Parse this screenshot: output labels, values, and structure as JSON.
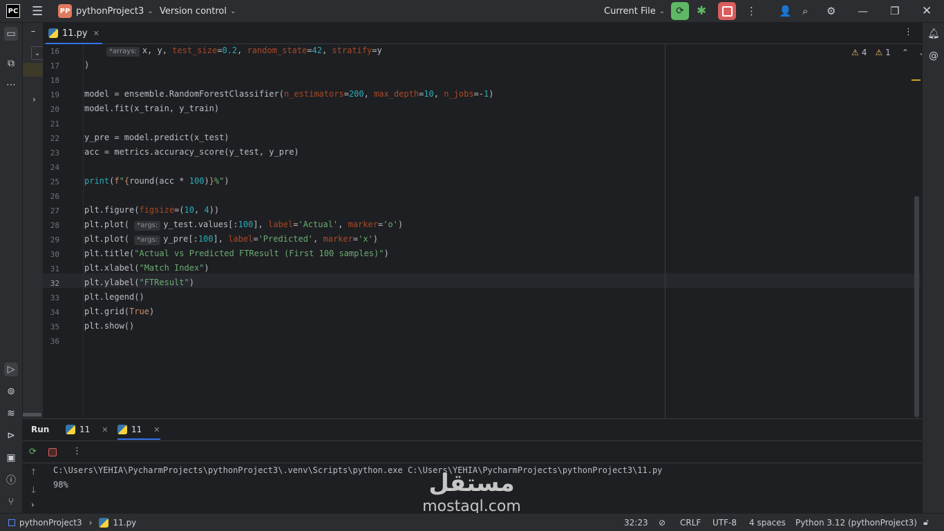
{
  "titlebar": {
    "logo": "PC",
    "project_badge": "PP",
    "project_name": "pythonProject3",
    "vcs": "Version control",
    "run_config": "Current File"
  },
  "editor": {
    "tab_file": "11.py",
    "inspection_warnings": "4",
    "inspection_weak": "1",
    "lines": [
      {
        "n": "16",
        "segs": [
          [
            "hint",
            "*arrays:"
          ],
          [
            "t",
            "x, y, "
          ],
          [
            "param",
            "test_size"
          ],
          [
            "t",
            "="
          ],
          [
            "num",
            "0.2"
          ],
          [
            "t",
            ", "
          ],
          [
            "param",
            "random_state"
          ],
          [
            "t",
            "="
          ],
          [
            "num",
            "42"
          ],
          [
            "t",
            ", "
          ],
          [
            "param",
            "stratify"
          ],
          [
            "t",
            "=y"
          ]
        ]
      },
      {
        "n": "17",
        "segs": [
          [
            "t",
            ")"
          ]
        ]
      },
      {
        "n": "18",
        "segs": []
      },
      {
        "n": "19",
        "segs": [
          [
            "t",
            "model = ensemble.RandomForestClassifier("
          ],
          [
            "param",
            "n_estimators"
          ],
          [
            "t",
            "="
          ],
          [
            "num",
            "200"
          ],
          [
            "t",
            ", "
          ],
          [
            "param",
            "max_depth"
          ],
          [
            "t",
            "="
          ],
          [
            "num",
            "10"
          ],
          [
            "t",
            ", "
          ],
          [
            "param",
            "n_jobs"
          ],
          [
            "t",
            "=-"
          ],
          [
            "num",
            "1"
          ],
          [
            "t",
            ")"
          ]
        ]
      },
      {
        "n": "20",
        "segs": [
          [
            "t",
            "model.fit(x_train, y_train)"
          ]
        ]
      },
      {
        "n": "21",
        "segs": []
      },
      {
        "n": "22",
        "segs": [
          [
            "t",
            "y_pre = model.predict(x_test)"
          ]
        ]
      },
      {
        "n": "23",
        "segs": [
          [
            "t",
            "acc = metrics.accuracy_score(y_test, y_pre)"
          ]
        ]
      },
      {
        "n": "24",
        "segs": []
      },
      {
        "n": "25",
        "segs": [
          [
            "num",
            "print"
          ],
          [
            "t",
            "("
          ],
          [
            "kw",
            "f"
          ],
          [
            "str",
            "\""
          ],
          [
            "kw",
            "{"
          ],
          [
            "t",
            "round(acc * "
          ],
          [
            "num",
            "100"
          ],
          [
            "t",
            ")"
          ],
          [
            "kw",
            "}"
          ],
          [
            "str",
            "%\""
          ],
          [
            "t",
            ")"
          ]
        ]
      },
      {
        "n": "26",
        "segs": []
      },
      {
        "n": "27",
        "segs": [
          [
            "t",
            "plt.figure("
          ],
          [
            "param",
            "figsize"
          ],
          [
            "t",
            "=("
          ],
          [
            "num",
            "10"
          ],
          [
            "t",
            ", "
          ],
          [
            "num",
            "4"
          ],
          [
            "t",
            "))"
          ]
        ]
      },
      {
        "n": "28",
        "segs": [
          [
            "t",
            "plt.plot( "
          ],
          [
            "hint",
            "*args:"
          ],
          [
            "t",
            "y_test.values[:"
          ],
          [
            "num",
            "100"
          ],
          [
            "t",
            "], "
          ],
          [
            "param",
            "label"
          ],
          [
            "t",
            "="
          ],
          [
            "str",
            "'Actual'"
          ],
          [
            "t",
            ", "
          ],
          [
            "param",
            "marker"
          ],
          [
            "t",
            "="
          ],
          [
            "str",
            "'o'"
          ],
          [
            "t",
            ")"
          ]
        ]
      },
      {
        "n": "29",
        "segs": [
          [
            "t",
            "plt.plot( "
          ],
          [
            "hint",
            "*args:"
          ],
          [
            "t",
            "y_pre[:"
          ],
          [
            "num",
            "100"
          ],
          [
            "t",
            "], "
          ],
          [
            "param",
            "label"
          ],
          [
            "t",
            "="
          ],
          [
            "str",
            "'Predicted'"
          ],
          [
            "t",
            ", "
          ],
          [
            "param",
            "marker"
          ],
          [
            "t",
            "="
          ],
          [
            "str",
            "'x'"
          ],
          [
            "t",
            ")"
          ]
        ]
      },
      {
        "n": "30",
        "segs": [
          [
            "t",
            "plt.title("
          ],
          [
            "str",
            "\"Actual vs Predicted FTResult (First 100 samples)\""
          ],
          [
            "t",
            ")"
          ]
        ]
      },
      {
        "n": "31",
        "segs": [
          [
            "t",
            "plt.xlabel("
          ],
          [
            "str",
            "\"Match Index\""
          ],
          [
            "t",
            ")"
          ]
        ]
      },
      {
        "n": "32",
        "segs": [
          [
            "t",
            "plt.ylabel("
          ],
          [
            "str",
            "\"FTResult\""
          ],
          [
            "t",
            ")"
          ]
        ]
      },
      {
        "n": "33",
        "segs": [
          [
            "t",
            "plt.legend()"
          ]
        ]
      },
      {
        "n": "34",
        "segs": [
          [
            "t",
            "plt.grid("
          ],
          [
            "kw",
            "True"
          ],
          [
            "t",
            ")"
          ]
        ]
      },
      {
        "n": "35",
        "segs": [
          [
            "t",
            "plt.show()"
          ]
        ]
      },
      {
        "n": "36",
        "segs": []
      }
    ]
  },
  "run": {
    "title": "Run",
    "tab1": "11",
    "tab2": "11",
    "command": "C:\\Users\\YEHIA\\PycharmProjects\\pythonProject3\\.venv\\Scripts\\python.exe C:\\Users\\YEHIA\\PycharmProjects\\pythonProject3\\11.py",
    "output": "98%"
  },
  "statusbar": {
    "project": "pythonProject3",
    "file": "11.py",
    "position": "32:23",
    "line_ending": "CRLF",
    "encoding": "UTF-8",
    "indent": "4 spaces",
    "interpreter": "Python 3.12 (pythonProject3)"
  },
  "watermark": {
    "arabic": "مستقل",
    "latin": "mostaql.com"
  }
}
